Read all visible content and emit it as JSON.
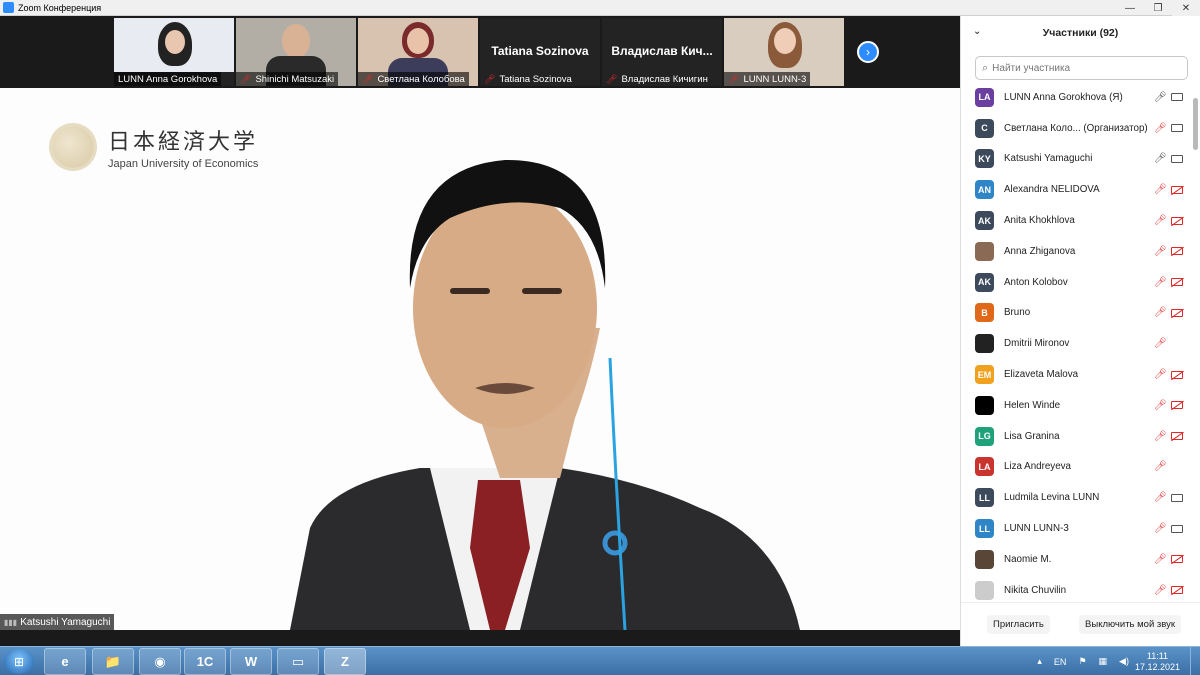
{
  "window": {
    "title": "Zoom Конференция",
    "controls": [
      "—",
      "❐",
      "✕"
    ]
  },
  "thumbnails": [
    {
      "name": "LUNN Anna Gorokhova",
      "muted": false,
      "video": true,
      "bg": "#dfe4ea"
    },
    {
      "name": "Shinichi Matsuzaki",
      "muted": true,
      "video": true,
      "bg": "#a8a39a"
    },
    {
      "name": "Светлана Колобова",
      "muted": true,
      "video": true,
      "bg": "#c9b3a2"
    },
    {
      "name": "Tatiana Sozinova",
      "muted": true,
      "video": false,
      "big": "Tatiana Sozinova"
    },
    {
      "name": "Владислав Кичигин",
      "muted": true,
      "video": false,
      "big": "Владислав  Кич..."
    },
    {
      "name": "LUNN LUNN-3",
      "muted": true,
      "video": true,
      "bg": "#cfc2b4"
    }
  ],
  "main": {
    "logo_jp": "日本経済大学",
    "logo_en": "Japan University of Economics",
    "speaker": "Katsushi Yamaguchi"
  },
  "panel": {
    "title": "Участники (92)",
    "search_placeholder": "Найти участника",
    "invite": "Пригласить",
    "mute_me": "Выключить мой звук",
    "participants": [
      {
        "initials": "LA",
        "color": "#6b3fa0",
        "name": "LUNN Anna Gorokhova (Я)",
        "mic": "on",
        "cam": "on"
      },
      {
        "initials": "С",
        "color": "#3d4a5c",
        "name": "Светлана Коло...  (Организатор)",
        "mic": "off",
        "cam": "on"
      },
      {
        "initials": "KY",
        "color": "#3d4a5c",
        "name": "Katsushi Yamaguchi",
        "mic": "on",
        "cam": "on"
      },
      {
        "initials": "AN",
        "color": "#2f86c6",
        "name": "Alexandra NELIDOVA",
        "mic": "off",
        "cam": "off"
      },
      {
        "initials": "AK",
        "color": "#3d4a5c",
        "name": "Anita Khokhlova",
        "mic": "off",
        "cam": "off"
      },
      {
        "initials": "",
        "color": "#8a6a55",
        "name": "Anna Zhiganova",
        "mic": "off",
        "cam": "off"
      },
      {
        "initials": "AK",
        "color": "#3d4a5c",
        "name": "Anton Kolobov",
        "mic": "off",
        "cam": "off"
      },
      {
        "initials": "B",
        "color": "#e0681a",
        "name": "Bruno",
        "mic": "off",
        "cam": "off"
      },
      {
        "initials": "",
        "color": "#222222",
        "name": "Dmitrii Mironov",
        "mic": "off",
        "cam": "none"
      },
      {
        "initials": "EM",
        "color": "#f0a21e",
        "name": "Elizaveta Malova",
        "mic": "off",
        "cam": "off"
      },
      {
        "initials": "",
        "color": "#000000",
        "name": "Helen Winde",
        "mic": "off",
        "cam": "off"
      },
      {
        "initials": "LG",
        "color": "#1fa27a",
        "name": "Lisa Granina",
        "mic": "off",
        "cam": "off"
      },
      {
        "initials": "LA",
        "color": "#c9342f",
        "name": "Liza Andreyeva",
        "mic": "off",
        "cam": "none"
      },
      {
        "initials": "LL",
        "color": "#3d4a5c",
        "name": "Ludmila Levina LUNN",
        "mic": "off",
        "cam": "on"
      },
      {
        "initials": "LL",
        "color": "#2f86c6",
        "name": "LUNN LUNN-3",
        "mic": "off",
        "cam": "on"
      },
      {
        "initials": "",
        "color": "#5a4636",
        "name": "Naomie M.",
        "mic": "off",
        "cam": "off"
      },
      {
        "initials": "",
        "color": "#cccccc",
        "name": "Nikita Chuvilin",
        "mic": "off",
        "cam": "off"
      }
    ]
  },
  "taskbar": {
    "apps": [
      "e",
      "📁",
      "◉",
      "1C",
      "W",
      "▭",
      "Z"
    ],
    "lang": "EN",
    "time": "11:11",
    "date": "17.12.2021"
  }
}
